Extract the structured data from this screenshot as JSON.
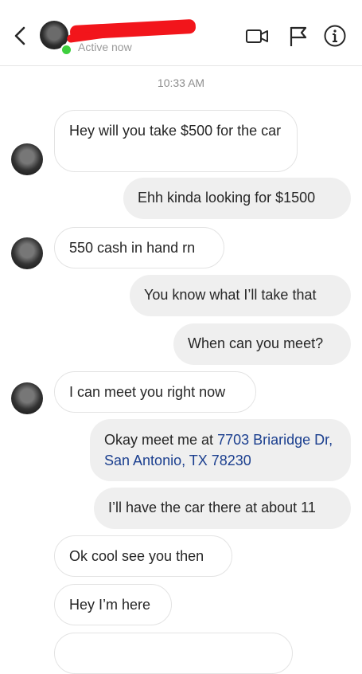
{
  "header": {
    "status": "Active now"
  },
  "timestamp": "10:33 AM",
  "messages": [
    {
      "text": "Hey will you take $500 for the car"
    },
    {
      "text": "Ehh kinda looking for $1500"
    },
    {
      "text": "550 cash in hand rn"
    },
    {
      "text": "You know what I’ll take that"
    },
    {
      "text": "When can you meet?"
    },
    {
      "text": "I can meet you right now"
    },
    {
      "prefix": "Okay meet me at ",
      "link": "7703 Briaridge Dr, San Antonio, TX 78230"
    },
    {
      "text": "I’ll have the car there at about 11"
    },
    {
      "text": "Ok cool see you then"
    },
    {
      "text": "Hey I’m here"
    }
  ],
  "colors": {
    "active": "#3dcf3d",
    "redaction": "#f2151b",
    "link": "#1b3f8f",
    "outgoing_bubble": "#efefef"
  },
  "icons": [
    "back-chevron-icon",
    "video-call-icon",
    "flag-icon",
    "info-icon"
  ]
}
